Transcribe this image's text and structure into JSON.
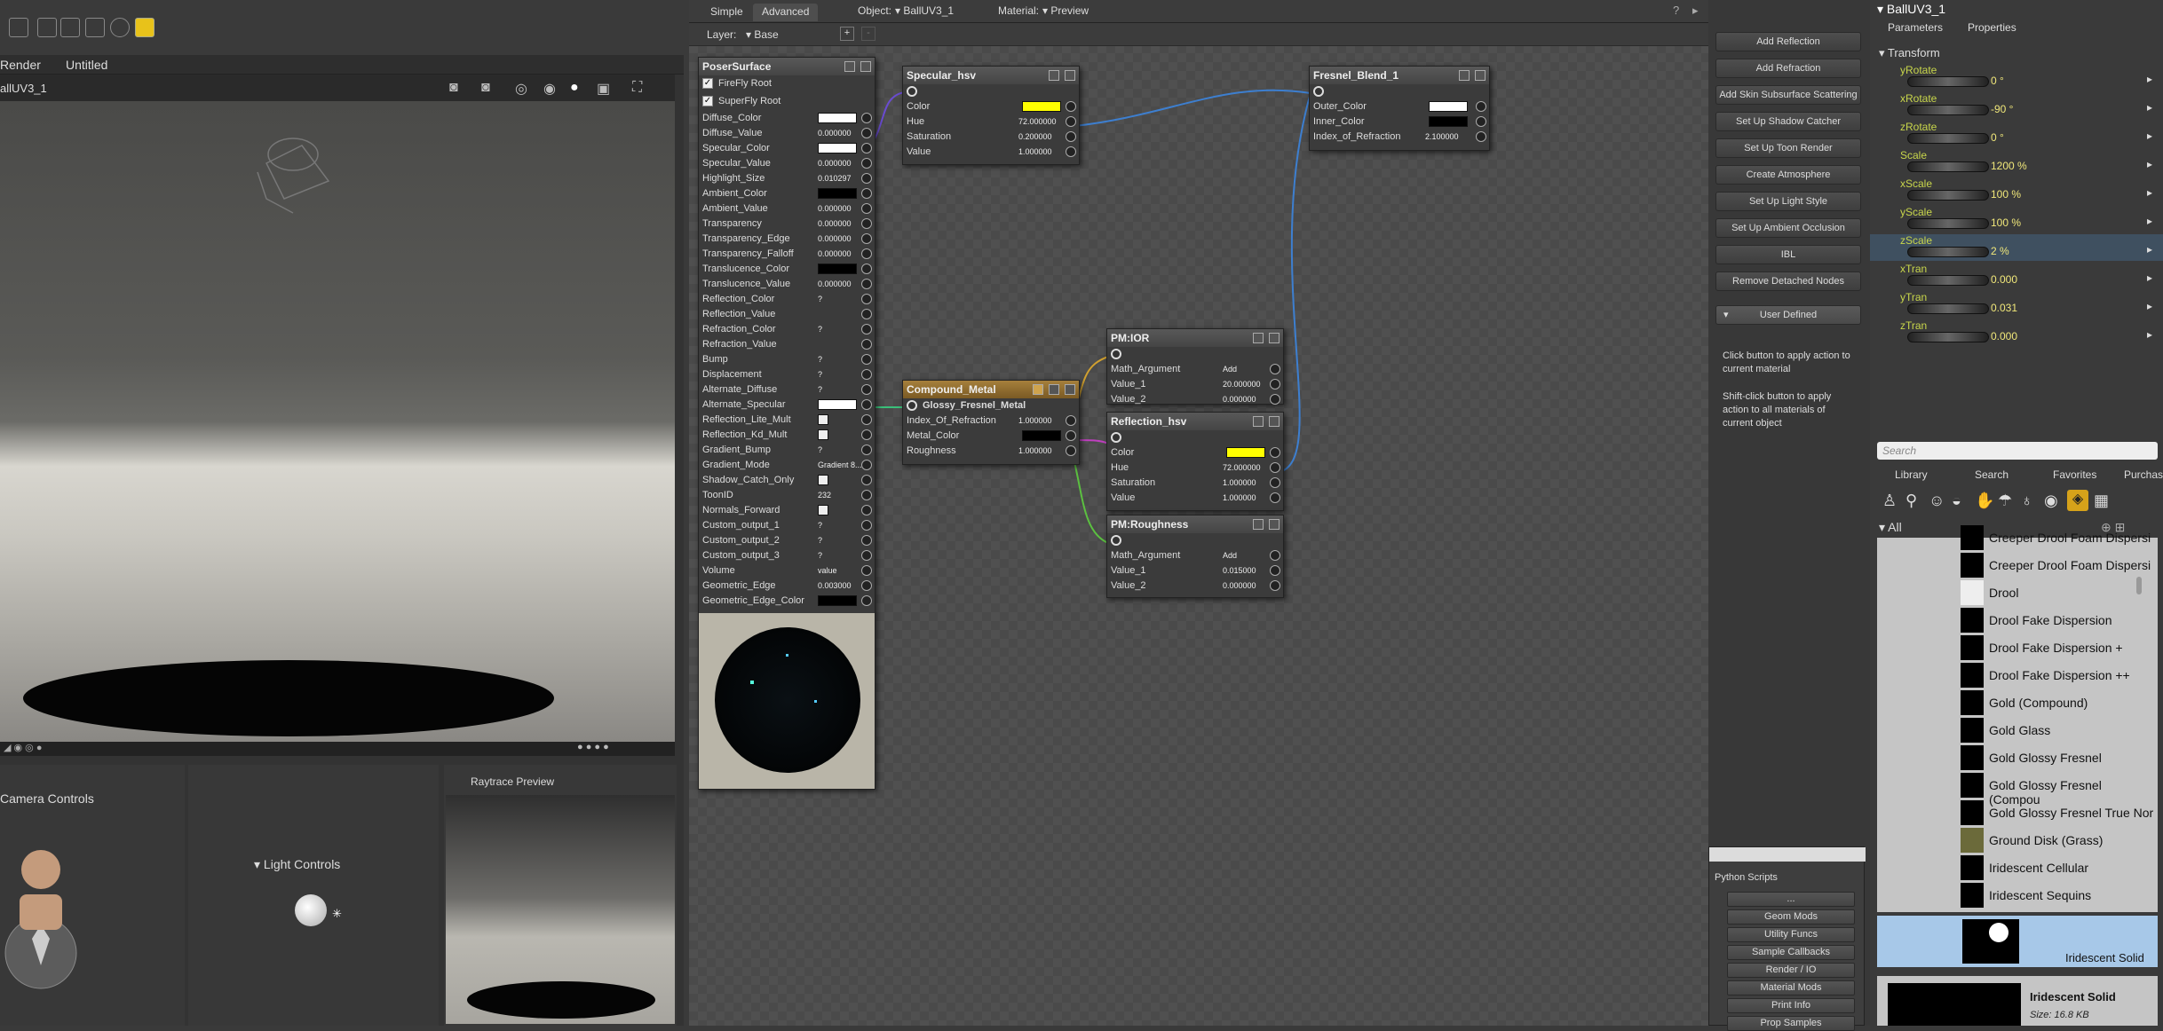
{
  "viewport": {
    "tab_render": "Render",
    "tab_untitled": "Untitled",
    "camera_label": "allUV3_1",
    "camera_controls": "Camera Controls",
    "light_controls": "Light Controls",
    "raytrace_preview": "Raytrace Preview"
  },
  "editor": {
    "tab_simple": "Simple",
    "tab_advanced": "Advanced",
    "object_label": "Object:",
    "object_value": "BallUV3_1",
    "material_label": "Material:",
    "material_value": "Preview",
    "layer_label": "Layer:",
    "layer_value": "Base",
    "add_btn": "+",
    "remove_btn": "-"
  },
  "poser_surface": {
    "title": "PoserSurface",
    "firefly": "FireFly Root",
    "superfly": "SuperFly Root",
    "rows": [
      {
        "name": "Diffuse_Color",
        "val": "",
        "swatch": "#ffffff"
      },
      {
        "name": "Diffuse_Value",
        "val": "0.000000"
      },
      {
        "name": "Specular_Color",
        "val": "",
        "swatch": "#ffffff"
      },
      {
        "name": "Specular_Value",
        "val": "0.000000"
      },
      {
        "name": "Highlight_Size",
        "val": "0.010297"
      },
      {
        "name": "Ambient_Color",
        "val": "",
        "swatch": "#000000"
      },
      {
        "name": "Ambient_Value",
        "val": "0.000000"
      },
      {
        "name": "Transparency",
        "val": "0.000000"
      },
      {
        "name": "Transparency_Edge",
        "val": "0.000000"
      },
      {
        "name": "Transparency_Falloff",
        "val": "0.000000"
      },
      {
        "name": "Translucence_Color",
        "val": "",
        "swatch": "#000000"
      },
      {
        "name": "Translucence_Value",
        "val": "0.000000"
      },
      {
        "name": "Reflection_Color",
        "val": "?"
      },
      {
        "name": "Reflection_Value",
        "val": ""
      },
      {
        "name": "Refraction_Color",
        "val": "?"
      },
      {
        "name": "Refraction_Value",
        "val": ""
      },
      {
        "name": "Bump",
        "val": "?"
      },
      {
        "name": "Displacement",
        "val": "?"
      },
      {
        "name": "Alternate_Diffuse",
        "val": "?"
      },
      {
        "name": "Alternate_Specular",
        "val": "",
        "swatch": "#ffffff"
      },
      {
        "name": "Reflection_Lite_Mult",
        "val": ""
      },
      {
        "name": "Reflection_Kd_Mult",
        "val": ""
      },
      {
        "name": "Gradient_Bump",
        "val": "?"
      },
      {
        "name": "Gradient_Mode",
        "val": "Gradient 8..."
      },
      {
        "name": "Shadow_Catch_Only",
        "val": ""
      },
      {
        "name": "ToonID",
        "val": "232"
      },
      {
        "name": "Normals_Forward",
        "val": ""
      },
      {
        "name": "Custom_output_1",
        "val": "?"
      },
      {
        "name": "Custom_output_2",
        "val": "?"
      },
      {
        "name": "Custom_output_3",
        "val": "?"
      },
      {
        "name": "Volume",
        "val": "value"
      },
      {
        "name": "Geometric_Edge",
        "val": "0.003000"
      },
      {
        "name": "Geometric_Edge_Color",
        "val": "",
        "swatch": "#000000"
      }
    ]
  },
  "specular_hsv": {
    "title": "Specular_hsv",
    "rows": [
      {
        "name": "Color",
        "val": "",
        "swatch": "#ffff00"
      },
      {
        "name": "Hue",
        "val": "72.000000"
      },
      {
        "name": "Saturation",
        "val": "0.200000"
      },
      {
        "name": "Value",
        "val": "1.000000"
      }
    ]
  },
  "fresnel_blend": {
    "title": "Fresnel_Blend_1",
    "rows": [
      {
        "name": "Outer_Color",
        "val": "",
        "swatch": "#ffffff"
      },
      {
        "name": "Inner_Color",
        "val": "",
        "swatch": "#000000"
      },
      {
        "name": "Index_of_Refraction",
        "val": "2.100000"
      }
    ]
  },
  "compound_metal": {
    "title": "Compound_Metal",
    "sub": "Glossy_Fresnel_Metal",
    "rows": [
      {
        "name": "Index_Of_Refraction",
        "val": "1.000000"
      },
      {
        "name": "Metal_Color",
        "val": "",
        "swatch": "#000000"
      },
      {
        "name": "Roughness",
        "val": "1.000000"
      }
    ]
  },
  "pm_ior": {
    "title": "PM:IOR",
    "rows": [
      {
        "name": "Math_Argument",
        "val": "Add"
      },
      {
        "name": "Value_1",
        "val": "20.000000"
      },
      {
        "name": "Value_2",
        "val": "0.000000"
      }
    ]
  },
  "reflection_hsv": {
    "title": "Reflection_hsv",
    "rows": [
      {
        "name": "Color",
        "val": "",
        "swatch": "#ffff00"
      },
      {
        "name": "Hue",
        "val": "72.000000"
      },
      {
        "name": "Saturation",
        "val": "1.000000"
      },
      {
        "name": "Value",
        "val": "1.000000"
      }
    ]
  },
  "pm_roughness": {
    "title": "PM:Roughness",
    "rows": [
      {
        "name": "Math_Argument",
        "val": "Add"
      },
      {
        "name": "Value_1",
        "val": "0.015000"
      },
      {
        "name": "Value_2",
        "val": "0.000000"
      }
    ]
  },
  "wizard": {
    "buttons": [
      "Add Reflection",
      "Add Refraction",
      "Add Skin Subsurface Scattering",
      "Set Up Shadow Catcher",
      "Set Up Toon Render",
      "Create Atmosphere",
      "Set Up Light Style",
      "Set Up Ambient Occlusion",
      "IBL",
      "Remove Detached Nodes"
    ],
    "user_defined": "User Defined",
    "help1": "Click button to apply action to current material",
    "help2": "Shift-click button to apply action to all materials of current object",
    "python_title": "Python Scripts",
    "python_buttons": [
      "...",
      "Geom Mods",
      "Utility Funcs",
      "Sample Callbacks",
      "Render / IO",
      "Material Mods",
      "Print Info",
      "Prop Samples"
    ]
  },
  "params": {
    "title": "BallUV3_1",
    "tab_parameters": "Parameters",
    "tab_properties": "Properties",
    "group": "Transform",
    "items": [
      {
        "name": "yRotate",
        "val": "0 °"
      },
      {
        "name": "xRotate",
        "val": "-90 °"
      },
      {
        "name": "zRotate",
        "val": "0 °"
      },
      {
        "name": "Scale",
        "val": "1200 %"
      },
      {
        "name": "xScale",
        "val": "100 %"
      },
      {
        "name": "yScale",
        "val": "100 %"
      },
      {
        "name": "zScale",
        "val": "2 %"
      },
      {
        "name": "xTran",
        "val": "0.000"
      },
      {
        "name": "yTran",
        "val": "0.031"
      },
      {
        "name": "zTran",
        "val": "0.000"
      }
    ]
  },
  "library": {
    "search_placeholder": "Search",
    "tabs": [
      "Library",
      "Search",
      "Favorites",
      "Purchases"
    ],
    "all": "All",
    "items": [
      "Creeper Drool Foam Dispersi",
      "Creeper Drool Foam Dispersi",
      "Drool",
      "Drool Fake Dispersion",
      "Drool Fake Dispersion +",
      "Drool Fake Dispersion ++",
      "Gold (Compound)",
      "Gold Glass",
      "Gold Glossy Fresnel",
      "Gold Glossy Fresnel (Compou",
      "Gold Glossy Fresnel True Nor",
      "Ground Disk (Grass)",
      "Iridescent Cellular",
      "Iridescent Sequins"
    ],
    "selected": "Iridescent Solid",
    "preview_name": "Iridescent Solid",
    "preview_size_label": "Size:",
    "preview_size": "16.8 KB"
  }
}
